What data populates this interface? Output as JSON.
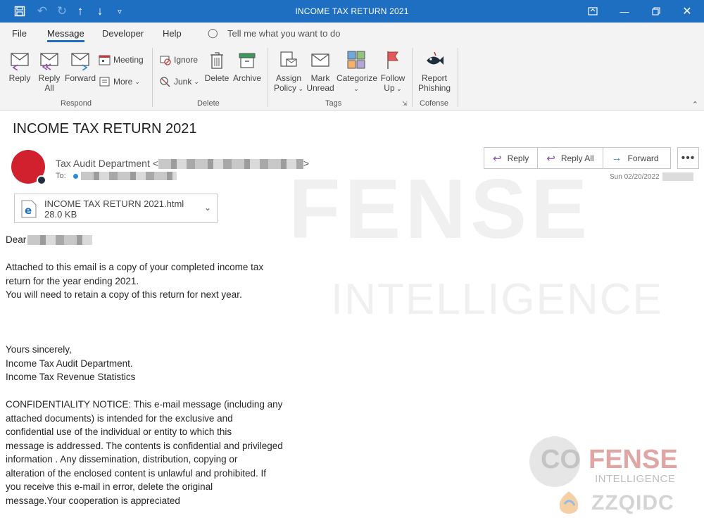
{
  "window": {
    "title": "INCOME TAX RETURN 2021",
    "quick_access": [
      "save-icon",
      "undo-icon",
      "redo-icon",
      "up-arrow-icon",
      "down-arrow-icon",
      "customize-icon"
    ],
    "controls": [
      "restore-icon",
      "minimize-icon",
      "maximize-icon",
      "close-icon"
    ]
  },
  "menu": {
    "tabs": [
      "File",
      "Message",
      "Developer",
      "Help"
    ],
    "active_tab": "Message",
    "tell_me": "Tell me what you want to do"
  },
  "ribbon": {
    "respond": {
      "label": "Respond",
      "reply": "Reply",
      "reply_all_1": "Reply",
      "reply_all_2": "All",
      "forward": "Forward",
      "meeting": "Meeting",
      "more": "More"
    },
    "delete": {
      "label": "Delete",
      "ignore": "Ignore",
      "junk": "Junk",
      "delete": "Delete",
      "archive": "Archive"
    },
    "tags": {
      "label": "Tags",
      "assign_1": "Assign",
      "assign_2": "Policy",
      "mark_1": "Mark",
      "mark_2": "Unread",
      "categorize": "Categorize",
      "follow_1": "Follow",
      "follow_2": "Up"
    },
    "cofense": {
      "label": "Cofense",
      "report_1": "Report",
      "report_2": "Phishing"
    }
  },
  "message": {
    "subject": "INCOME TAX RETURN 2021",
    "sender_name": "Tax Audit Department <",
    "sender_end": ">",
    "to_label": "To:",
    "date": "Sun 02/20/2022",
    "actions": {
      "reply": "Reply",
      "reply_all": "Reply All",
      "forward": "Forward",
      "more": "•••"
    },
    "attachment": {
      "name": "INCOME TAX RETURN 2021.html",
      "size": "28.0 KB"
    },
    "greeting": "Dear",
    "body_lines": [
      "Attached to this email is a copy of your completed income tax",
      "return for the year ending 2021.",
      "You will need to retain a copy of this return for next year."
    ],
    "signoff": [
      "Yours sincerely,",
      "Income Tax Audit Department.",
      "Income Tax Revenue Statistics"
    ],
    "notice": [
      "CONFIDENTIALITY NOTICE: This e-mail message (including any",
      "attached  documents) is intended for the exclusive and",
      "confidential use of the individual or entity to which this",
      "message is addressed. The contents is confidential and privileged",
      "information . Any dissemination, distribution, copying or",
      "alteration of the enclosed content is unlawful and prohibited. If",
      "you receive this e-mail in error,  delete the original",
      "message.Your cooperation is appreciated"
    ]
  },
  "watermarks": {
    "big_1": "FENSE",
    "big_2": "INTELLIGENCE",
    "logo_co": "CO",
    "logo_fense": "FENSE",
    "logo_intel": "INTELLIGENCE",
    "site": "ZZQIDC"
  },
  "colors": {
    "title_bar": "#1e6fc2",
    "avatar": "#d1202e",
    "accent": "#1e6fc2"
  }
}
